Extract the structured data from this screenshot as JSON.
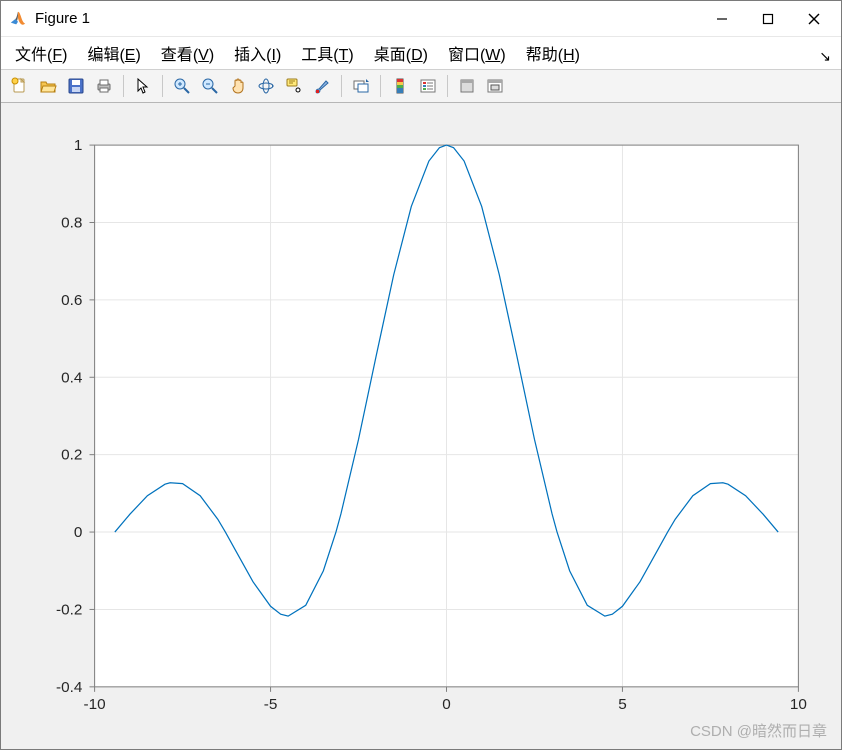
{
  "window": {
    "title": "Figure 1",
    "minimize_tip": "Minimize",
    "maximize_tip": "Maximize",
    "close_tip": "Close"
  },
  "menubar": {
    "items": [
      {
        "label": "文件",
        "accel": "F"
      },
      {
        "label": "编辑",
        "accel": "E"
      },
      {
        "label": "查看",
        "accel": "V"
      },
      {
        "label": "插入",
        "accel": "I"
      },
      {
        "label": "工具",
        "accel": "T"
      },
      {
        "label": "桌面",
        "accel": "D"
      },
      {
        "label": "窗口",
        "accel": "W"
      },
      {
        "label": "帮助",
        "accel": "H"
      }
    ]
  },
  "toolbar": {
    "new_tip": "新建图窗",
    "open_tip": "打开",
    "save_tip": "保存",
    "print_tip": "打印",
    "select_tip": "选择",
    "zoom_in_tip": "放大",
    "zoom_out_tip": "缩小",
    "pan_tip": "平移",
    "rotate_tip": "三维旋转",
    "datatip_tip": "数据游标",
    "brush_tip": "刷选/取消刷选",
    "link_tip": "链接图",
    "colorbar_tip": "插入颜色栏",
    "legend_tip": "插入图例",
    "hide_tip": "隐藏绘图工具",
    "dock_tip": "停靠图窗"
  },
  "colors": {
    "line": "#0072BD",
    "axes_bg": "#ffffff",
    "grid": "#e6e6e6",
    "axes_border": "#808080",
    "tick_text": "#262626",
    "body_bg": "#f0f0f0"
  },
  "chart_data": {
    "type": "line",
    "title": "",
    "xlabel": "",
    "ylabel": "",
    "xlim": [
      -10,
      10
    ],
    "ylim": [
      -0.4,
      1.0
    ],
    "xticks": [
      -10,
      -5,
      0,
      5,
      10
    ],
    "yticks": [
      -0.4,
      -0.2,
      0,
      0.2,
      0.4,
      0.6,
      0.8,
      1.0
    ],
    "grid": true,
    "function": "sinc(x) = sin(x)/x over [-3π, 3π]",
    "x": [
      -9.4248,
      -9.0,
      -8.5,
      -8.0,
      -7.854,
      -7.5,
      -7.0,
      -6.5,
      -6.2832,
      -6.0,
      -5.5,
      -5.0,
      -4.7124,
      -4.5,
      -4.0,
      -3.5,
      -3.1416,
      -3.0,
      -2.5,
      -2.0,
      -1.5,
      -1.0,
      -0.5,
      -0.2,
      0.0,
      0.2,
      0.5,
      1.0,
      1.5,
      2.0,
      2.5,
      3.0,
      3.1416,
      3.5,
      4.0,
      4.5,
      4.7124,
      5.0,
      5.5,
      6.0,
      6.2832,
      6.5,
      7.0,
      7.5,
      7.854,
      8.0,
      8.5,
      9.0,
      9.4248
    ],
    "y": [
      0.0,
      0.0458,
      0.0939,
      0.1237,
      0.1274,
      0.1251,
      0.0939,
      0.0331,
      0.0,
      -0.0466,
      -0.1283,
      -0.1918,
      -0.2122,
      -0.2172,
      -0.1892,
      -0.1003,
      0.0,
      0.047,
      0.2394,
      0.4546,
      0.665,
      0.8415,
      0.9589,
      0.9933,
      1.0,
      0.9933,
      0.9589,
      0.8415,
      0.665,
      0.4546,
      0.2394,
      0.047,
      0.0,
      -0.1003,
      -0.1892,
      -0.2172,
      -0.2122,
      -0.1918,
      -0.1283,
      -0.0466,
      0.0,
      0.0331,
      0.0939,
      0.1251,
      0.1274,
      0.1237,
      0.0939,
      0.0458,
      0.0
    ]
  },
  "watermark": "CSDN @暗然而日章"
}
